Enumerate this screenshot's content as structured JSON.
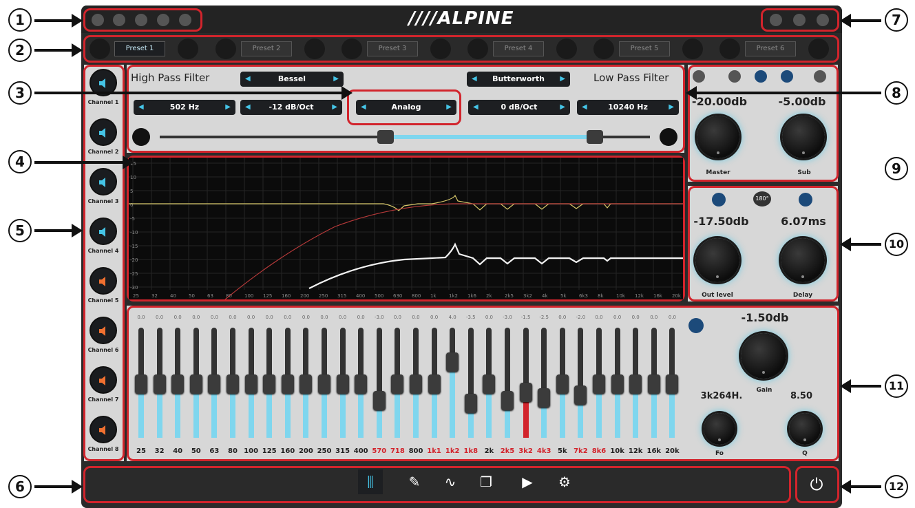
{
  "callouts": [
    "1",
    "2",
    "3",
    "4",
    "5",
    "6",
    "7",
    "8",
    "9",
    "10",
    "11",
    "12"
  ],
  "header": {
    "brand": "////ALPINE",
    "left_icons": [
      "pen-icon",
      "speaker-icon",
      "camera-icon",
      "thermometer-icon",
      "bolt-icon"
    ],
    "right_icons": [
      "wifi-icon",
      "headset-icon",
      "phone-icon"
    ]
  },
  "presets": [
    "Preset 1",
    "Preset 2",
    "Preset 3",
    "Preset 4",
    "Preset 5",
    "Preset 6"
  ],
  "filters": {
    "hp_title": "High Pass Filter",
    "lp_title": "Low Pass Filter",
    "hp_type": "Bessel",
    "lp_type": "Butterworth",
    "hp_freq": "502 Hz",
    "hp_slope": "-12 dB/Oct",
    "mode": "Analog",
    "lp_slope": "0 dB/Oct",
    "lp_freq": "10240 Hz"
  },
  "channels": [
    "Channel 1",
    "Channel 2",
    "Channel 3",
    "Channel 4",
    "Channel 5",
    "Channel 6",
    "Channel 7",
    "Channel 8"
  ],
  "graph": {
    "y_labels": [
      "15",
      "10",
      "5",
      "0",
      "-5",
      "-10",
      "-15",
      "-20",
      "-25",
      "-30"
    ],
    "x_labels": [
      "25",
      "32",
      "40",
      "50",
      "63",
      "80",
      "100",
      "125",
      "160",
      "200",
      "250",
      "315",
      "400",
      "500",
      "630",
      "800",
      "1k",
      "1k2",
      "1k6",
      "2k",
      "2k5",
      "3k2",
      "4k",
      "5k",
      "6k3",
      "8k",
      "10k",
      "12k",
      "16k",
      "20k"
    ]
  },
  "master": {
    "master_value": "-20.00db",
    "sub_value": "-5.00db",
    "master_label": "Master",
    "sub_label": "Sub"
  },
  "output": {
    "level_value": "-17.50db",
    "delay_value": "6.07ms",
    "level_label": "Out level",
    "delay_label": "Delay",
    "phase": "180°"
  },
  "eq": {
    "values": [
      "0.0",
      "0.0",
      "0.0",
      "0.0",
      "0.0",
      "0.0",
      "0.0",
      "0.0",
      "0.0",
      "0.0",
      "0.0",
      "0.0",
      "0.0",
      "-3.0",
      "0.0",
      "0.0",
      "0.0",
      "4.0",
      "-3.5",
      "0.0",
      "-3.0",
      "-1.5",
      "-2.5",
      "0.0",
      "-2.0",
      "0.0",
      "0.0",
      "0.0",
      "0.0",
      "0.0"
    ],
    "bands": [
      "25",
      "32",
      "40",
      "50",
      "63",
      "80",
      "100",
      "125",
      "160",
      "200",
      "250",
      "315",
      "400",
      "570",
      "718",
      "800",
      "1k1",
      "1k2",
      "1k8",
      "2k",
      "2k5",
      "3k2",
      "4k3",
      "5k",
      "7k2",
      "8k6",
      "10k",
      "12k",
      "16k",
      "20k"
    ],
    "gain_value": "-1.50db",
    "gain_label": "Gain",
    "fo_value": "3k264H.",
    "fo_label": "Fo",
    "q_value": "8.50",
    "q_label": "Q"
  },
  "colors": {
    "accent": "#45c4e6",
    "callout_red": "#d2242c",
    "orange": "#f07030",
    "panel": "#d7d7d7",
    "frame": "#2b2b2b"
  }
}
